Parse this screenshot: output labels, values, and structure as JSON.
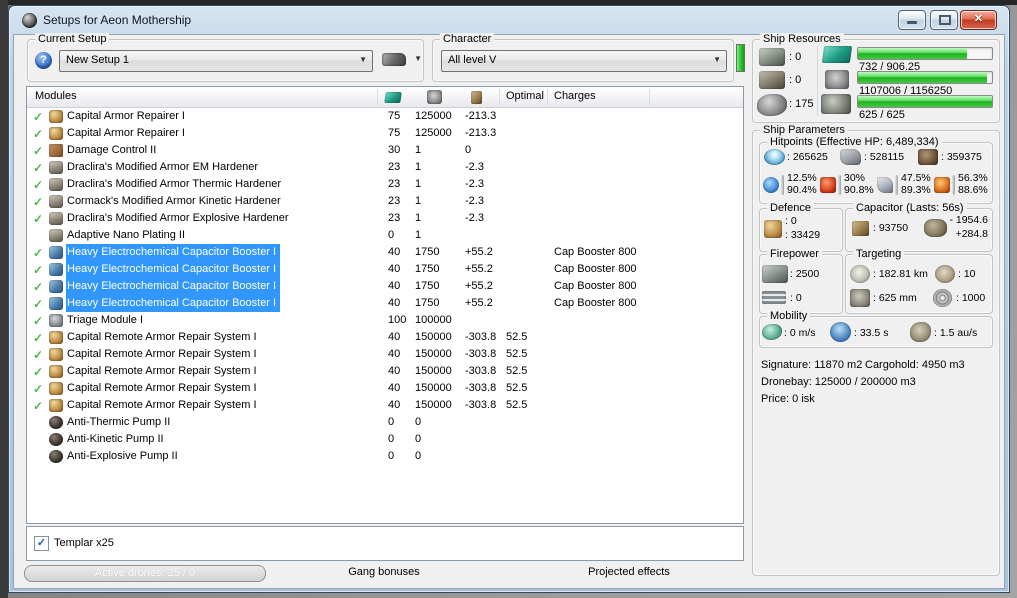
{
  "colors": {
    "selection_blue": "#3297fd",
    "bar_green": "#2ec82e",
    "indicator_green": "#35d435",
    "close_button_red": "#c23c22",
    "title_gradient_top": "#d7e5f2"
  },
  "icons": {
    "check": "✓",
    "help": "?",
    "combo_arrow": "▼",
    "close": "✕",
    "checkbox_check": "✓"
  },
  "window": {
    "title": "Setups for Aeon Mothership"
  },
  "setup_group": {
    "label": "Current Setup",
    "value": "New Setup 1"
  },
  "character_group": {
    "label": "Character",
    "value": "All level V"
  },
  "modules_table": {
    "columns": {
      "modules": "Modules",
      "optimal": "Optimal",
      "charges": "Charges"
    },
    "rows": [
      {
        "checked": true,
        "icon": "repairer",
        "name": "Capital Armor Repairer I",
        "cpu": "75",
        "pg": "125000",
        "cap": "-213.3",
        "optimal": "",
        "charges": "",
        "selected": false
      },
      {
        "checked": true,
        "icon": "repairer",
        "name": "Capital Armor Repairer I",
        "cpu": "75",
        "pg": "125000",
        "cap": "-213.3",
        "optimal": "",
        "charges": "",
        "selected": false
      },
      {
        "checked": true,
        "icon": "dcu",
        "name": "Damage Control II",
        "cpu": "30",
        "pg": "1",
        "cap": "0",
        "optimal": "",
        "charges": "",
        "selected": false
      },
      {
        "checked": true,
        "icon": "hardener",
        "name": "Draclira's Modified Armor EM Hardener",
        "cpu": "23",
        "pg": "1",
        "cap": "-2.3",
        "optimal": "",
        "charges": "",
        "selected": false
      },
      {
        "checked": true,
        "icon": "hardener",
        "name": "Draclira's Modified Armor Thermic Hardener",
        "cpu": "23",
        "pg": "1",
        "cap": "-2.3",
        "optimal": "",
        "charges": "",
        "selected": false
      },
      {
        "checked": true,
        "icon": "hardener",
        "name": "Cormack's Modified Armor Kinetic Hardener",
        "cpu": "23",
        "pg": "1",
        "cap": "-2.3",
        "optimal": "",
        "charges": "",
        "selected": false
      },
      {
        "checked": true,
        "icon": "hardener",
        "name": "Draclira's Modified Armor Explosive Hardener",
        "cpu": "23",
        "pg": "1",
        "cap": "-2.3",
        "optimal": "",
        "charges": "",
        "selected": false
      },
      {
        "checked": false,
        "icon": "hardener",
        "name": "Adaptive Nano Plating II",
        "cpu": "0",
        "pg": "1",
        "cap": "",
        "optimal": "",
        "charges": "",
        "selected": false
      },
      {
        "checked": true,
        "icon": "capbooster",
        "name": "Heavy Electrochemical Capacitor Booster I",
        "cpu": "40",
        "pg": "1750",
        "cap": "+55.2",
        "optimal": "",
        "charges": "Cap Booster 800",
        "selected": true
      },
      {
        "checked": true,
        "icon": "capbooster",
        "name": "Heavy Electrochemical Capacitor Booster I",
        "cpu": "40",
        "pg": "1750",
        "cap": "+55.2",
        "optimal": "",
        "charges": "Cap Booster 800",
        "selected": true
      },
      {
        "checked": true,
        "icon": "capbooster",
        "name": "Heavy Electrochemical Capacitor Booster I",
        "cpu": "40",
        "pg": "1750",
        "cap": "+55.2",
        "optimal": "",
        "charges": "Cap Booster 800",
        "selected": true
      },
      {
        "checked": true,
        "icon": "capbooster",
        "name": "Heavy Electrochemical Capacitor Booster I",
        "cpu": "40",
        "pg": "1750",
        "cap": "+55.2",
        "optimal": "",
        "charges": "Cap Booster 800",
        "selected": true
      },
      {
        "checked": true,
        "icon": "triage",
        "name": "Triage Module I",
        "cpu": "100",
        "pg": "100000",
        "cap": "",
        "optimal": "",
        "charges": "",
        "selected": false
      },
      {
        "checked": true,
        "icon": "remote",
        "name": "Capital Remote Armor Repair System I",
        "cpu": "40",
        "pg": "150000",
        "cap": "-303.8",
        "optimal": "52.5",
        "charges": "",
        "selected": false
      },
      {
        "checked": true,
        "icon": "remote",
        "name": "Capital Remote Armor Repair System I",
        "cpu": "40",
        "pg": "150000",
        "cap": "-303.8",
        "optimal": "52.5",
        "charges": "",
        "selected": false
      },
      {
        "checked": true,
        "icon": "remote",
        "name": "Capital Remote Armor Repair System I",
        "cpu": "40",
        "pg": "150000",
        "cap": "-303.8",
        "optimal": "52.5",
        "charges": "",
        "selected": false
      },
      {
        "checked": true,
        "icon": "remote",
        "name": "Capital Remote Armor Repair System I",
        "cpu": "40",
        "pg": "150000",
        "cap": "-303.8",
        "optimal": "52.5",
        "charges": "",
        "selected": false
      },
      {
        "checked": true,
        "icon": "remote",
        "name": "Capital Remote Armor Repair System I",
        "cpu": "40",
        "pg": "150000",
        "cap": "-303.8",
        "optimal": "52.5",
        "charges": "",
        "selected": false
      },
      {
        "checked": false,
        "icon": "pump",
        "name": "Anti-Thermic Pump II",
        "cpu": "0",
        "pg": "0",
        "cap": "",
        "optimal": "",
        "charges": "",
        "selected": false
      },
      {
        "checked": false,
        "icon": "pump",
        "name": "Anti-Kinetic Pump II",
        "cpu": "0",
        "pg": "0",
        "cap": "",
        "optimal": "",
        "charges": "",
        "selected": false
      },
      {
        "checked": false,
        "icon": "pump",
        "name": "Anti-Explosive Pump II",
        "cpu": "0",
        "pg": "0",
        "cap": "",
        "optimal": "",
        "charges": "",
        "selected": false
      }
    ]
  },
  "drones_panel": {
    "items": [
      {
        "label": "Templar x25",
        "checked": true
      }
    ]
  },
  "bottom_bar": {
    "active_drones": "Active drones: 25 / 0",
    "gang_bonuses": "Gang bonuses",
    "projected_effects": "Projected effects"
  },
  "ship_resources": {
    "label": "Ship Resources",
    "turrets": ": 0",
    "launchers": ": 0",
    "calibration": ": 175",
    "cpu": {
      "text": "732 / 906.25",
      "pct": 81
    },
    "powergrid": {
      "text": "1107006 / 1156250",
      "pct": 96
    },
    "drones": {
      "text": "625 / 625",
      "pct": 100
    }
  },
  "ship_parameters": {
    "label": "Ship Parameters",
    "hitpoints": {
      "label": "Hitpoints (Effective HP: 6,489,334)",
      "shield": ": 265625",
      "armor": ": 528115",
      "structure": ": 359375",
      "resists": [
        {
          "type": "em",
          "shield": "12.5%",
          "armor": "90.4%"
        },
        {
          "type": "thermal",
          "shield": "30%",
          "armor": "90.8%"
        },
        {
          "type": "kinetic",
          "shield": "47.5%",
          "armor": "89.3%"
        },
        {
          "type": "explosive",
          "shield": "56.3%",
          "armor": "88.6%"
        }
      ]
    },
    "defence": {
      "label": "Defence",
      "shield_rate": ": 0",
      "armor_rate": ": 33429"
    },
    "capacitor": {
      "label": "Capacitor (Lasts: 56s)",
      "amount": ": 93750",
      "drain": "- 1954.6",
      "recharge": "+284.8"
    },
    "firepower": {
      "label": "Firepower",
      "volley": ": 2500",
      "dps": ": 0"
    },
    "targeting": {
      "label": "Targeting",
      "range": ": 182.81 km",
      "max_targets": ": 10",
      "scan_resolution": ": 625 mm",
      "sensor_strength": ": 1000"
    },
    "mobility": {
      "label": "Mobility",
      "speed": ": 0 m/s",
      "align_time": ": 33.5 s",
      "warp_speed": ": 1.5 au/s"
    },
    "stats": {
      "signature": "Signature: 11870 m2",
      "cargohold": "Cargohold: 4950 m3",
      "dronebay": "Dronebay: 125000 / 200000 m3",
      "price": "Price: 0 isk"
    }
  }
}
